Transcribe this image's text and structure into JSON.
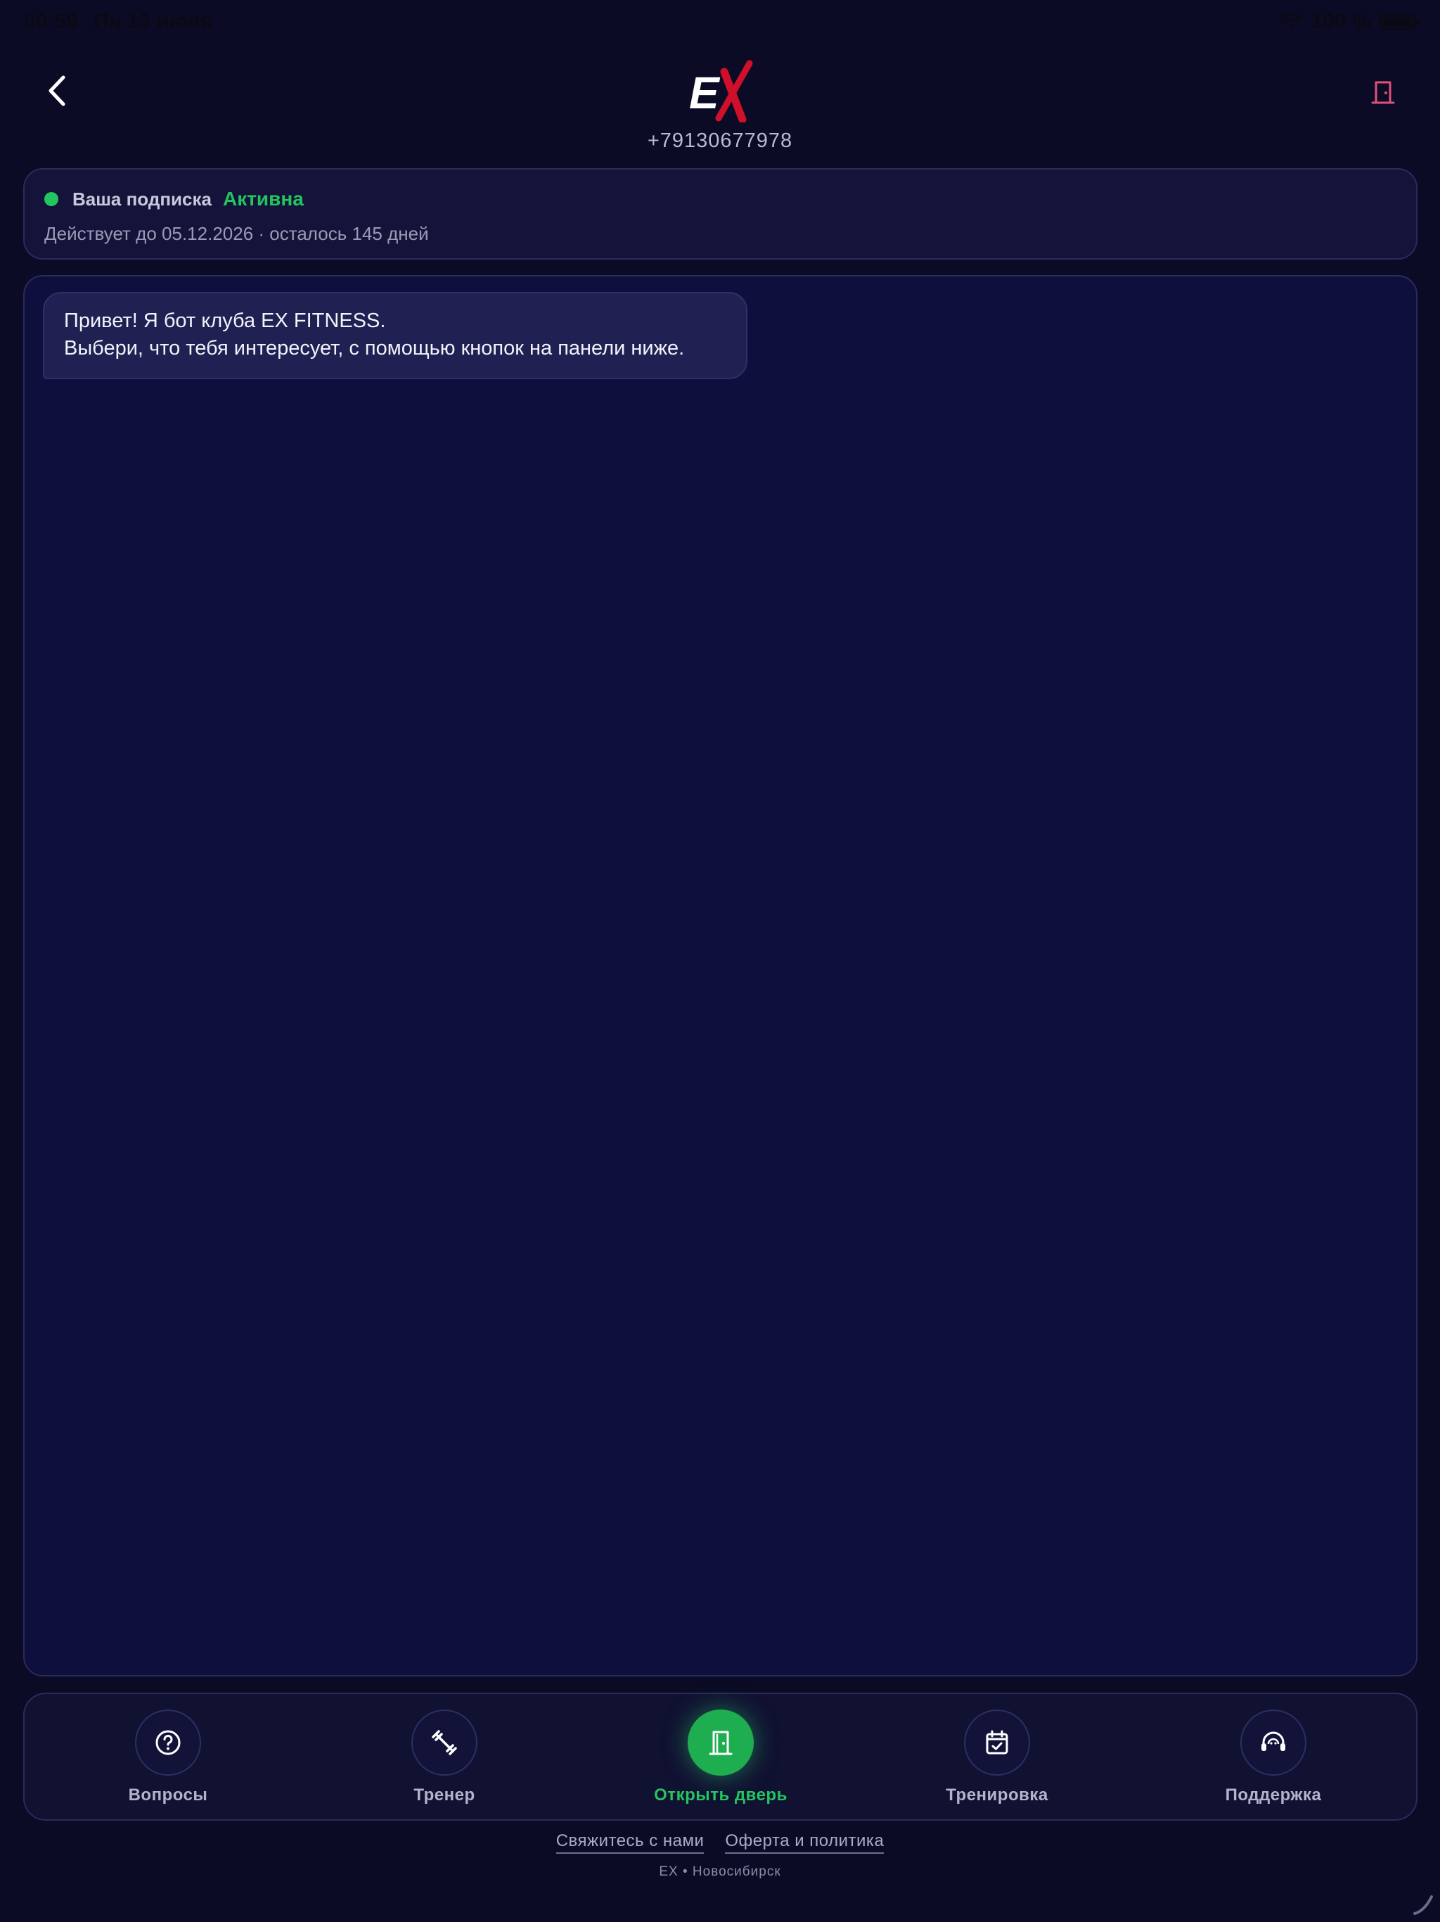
{
  "status_bar": {
    "time": "00:59",
    "date": "Пн 13 июля",
    "battery": "100 %"
  },
  "header": {
    "logo_text": "EX",
    "phone": "+79130677978"
  },
  "subscription": {
    "label": "Ваша подписка",
    "status": "Активна",
    "details": "Действует до 05.12.2026 · осталось 145 дней"
  },
  "chat": {
    "bot_message": {
      "line1": "Привет! Я бот клуба EX FITNESS.",
      "line2": "Выбери, что тебя интересует, с помощью кнопок на панели ниже."
    }
  },
  "nav": {
    "items": [
      {
        "label": "Вопросы",
        "icon": "question-icon"
      },
      {
        "label": "Тренер",
        "icon": "dumbbell-icon"
      },
      {
        "label": "Открыть дверь",
        "icon": "door-icon",
        "active": true
      },
      {
        "label": "Тренировка",
        "icon": "calendar-check-icon"
      },
      {
        "label": "Поддержка",
        "icon": "headset-icon"
      }
    ]
  },
  "footer": {
    "contact": "Свяжитесь с нами",
    "offer": "Оферта и политика",
    "city": "EX • Новосибирск"
  },
  "colors": {
    "background": "#0b0b26",
    "accent_green": "#22c55e",
    "logo_red": "#d0102a",
    "door_pink": "#e0507a"
  }
}
